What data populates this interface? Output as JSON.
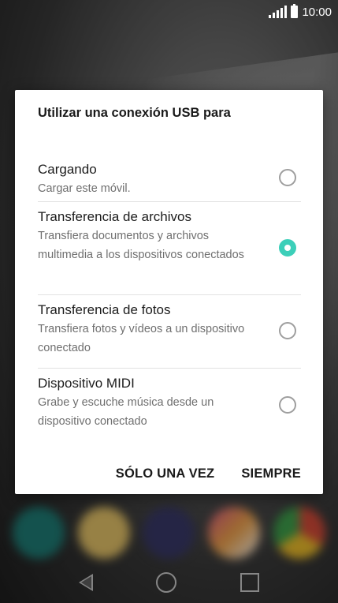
{
  "status_bar": {
    "time": "10:00",
    "icons": [
      "signal-icon",
      "battery-icon"
    ]
  },
  "dialog": {
    "title": "Utilizar una conexión USB para",
    "options": [
      {
        "title": "Cargando",
        "description": "Cargar este móvil.",
        "selected": false
      },
      {
        "title": "Transferencia de archivos",
        "description": "Transfiera documentos y archivos multimedia a los dispositivos conectados",
        "selected": true
      },
      {
        "title": "Transferencia de fotos",
        "description": "Transfiera fotos y vídeos a un dispositivo conectado",
        "selected": false
      },
      {
        "title": "Dispositivo MIDI",
        "description": "Grabe y escuche música desde un dispositivo conectado",
        "selected": false
      }
    ],
    "actions": {
      "once_label": "SÓLO UNA VEZ",
      "always_label": "SIEMPRE"
    }
  },
  "colors": {
    "accent": "#3ccfb9",
    "dialog_bg": "#ffffff",
    "title_text": "#1a1a1a",
    "desc_text": "#6f6f6f"
  },
  "dock": {
    "icons": [
      "phone-app-icon",
      "messages-app-icon",
      "camera-app-icon",
      "gallery-app-icon",
      "chrome-app-icon"
    ]
  },
  "nav_bar": {
    "icons": [
      "back-icon",
      "home-icon",
      "recents-icon"
    ]
  }
}
